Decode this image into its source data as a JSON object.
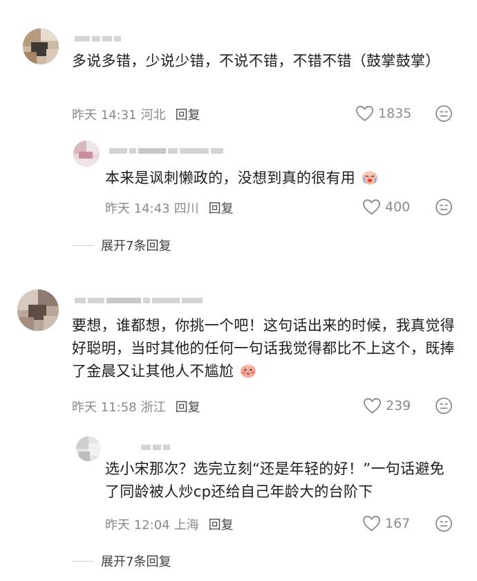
{
  "comments": [
    {
      "text": "多说多错，少说少错，不说不错，不错不错（鼓掌鼓掌）",
      "time": "昨天 14:31",
      "location": "河北",
      "reply_label": "回复",
      "likes": "1835",
      "replies": [
        {
          "text": "本来是讽刺懒政的，没想到真的很有用",
          "time": "昨天 14:43",
          "location": "四川",
          "reply_label": "回复",
          "likes": "400"
        }
      ],
      "expand_label": "展开7条回复"
    },
    {
      "text": "要想，谁都想，你挑一个吧！这句话出来的时候，我真觉得好聪明，当时其他的任何一句话我觉得都比不上这个，既捧了金晨又让其他人不尴尬",
      "time": "昨天 11:58",
      "location": "浙江",
      "reply_label": "回复",
      "likes": "239",
      "replies": [
        {
          "text": "选小宋那次？选完立刻“还是年轻的好！”一句话避免了同龄被人炒cp还给自己年龄大的台阶下",
          "time": "昨天 12:04",
          "location": "上海",
          "reply_label": "回复",
          "likes": "167"
        }
      ],
      "expand_label": "展开7条回复"
    }
  ],
  "icons": {
    "like": "heart-outline-icon",
    "dislike": "neutral-face-icon",
    "emoji1": "crying-face-emoji",
    "emoji2": "blushing-face-emoji"
  }
}
